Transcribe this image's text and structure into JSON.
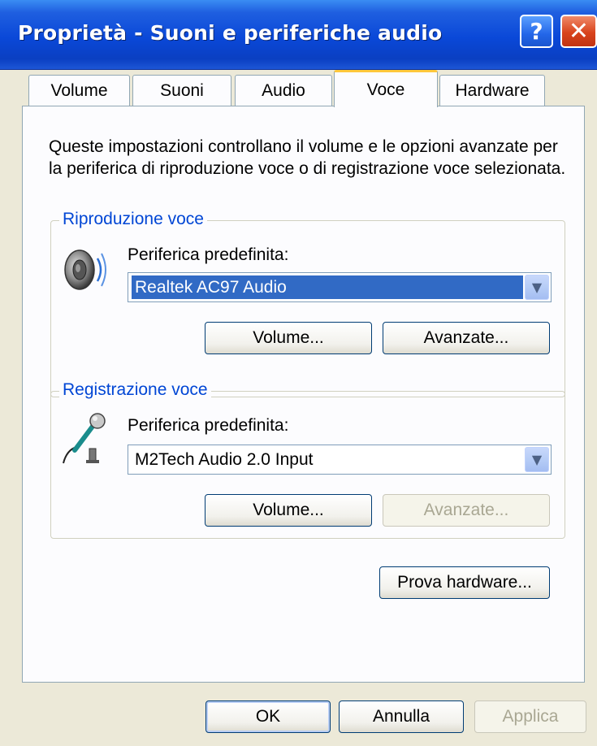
{
  "window": {
    "title": "Proprietà - Suoni e periferiche audio",
    "help_glyph": "?",
    "close_glyph": "✕"
  },
  "tabs": [
    {
      "label": "Volume",
      "active": false
    },
    {
      "label": "Suoni",
      "active": false
    },
    {
      "label": "Audio",
      "active": false
    },
    {
      "label": "Voce",
      "active": true
    },
    {
      "label": "Hardware",
      "active": false
    }
  ],
  "description": {
    "line1": "Queste impostazioni controllano il volume e le opzioni avanzate per",
    "line2": "la periferica di riproduzione voce o di registrazione voce selezionata."
  },
  "playback": {
    "group_label": "Riproduzione voce",
    "icon": "speaker-icon",
    "device_label": "Periferica predefinita:",
    "device_value": "Realtek AC97 Audio",
    "volume_button": "Volume...",
    "advanced_button": "Avanzate...",
    "advanced_enabled": true
  },
  "recording": {
    "group_label": "Registrazione voce",
    "icon": "microphone-icon",
    "device_label": "Periferica predefinita:",
    "device_value": "M2Tech Audio 2.0 Input",
    "volume_button": "Volume...",
    "advanced_button": "Avanzate...",
    "advanced_enabled": false
  },
  "test_hardware_button": "Prova hardware...",
  "footer": {
    "ok": "OK",
    "cancel": "Annulla",
    "apply": "Applica",
    "apply_enabled": false
  },
  "colors": {
    "title_bar": "#0a48d8",
    "group_label": "#0046d5",
    "selection": "#316ac5",
    "dialog_bg": "#ece9d8"
  }
}
